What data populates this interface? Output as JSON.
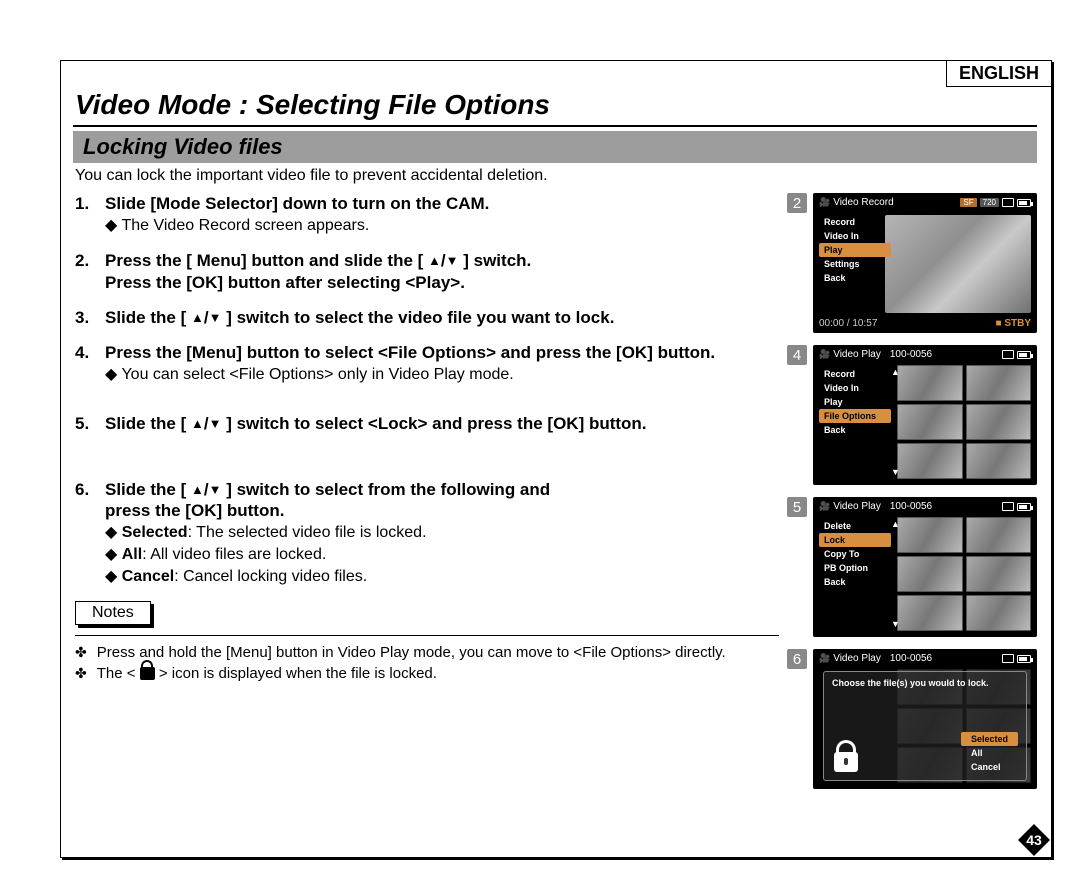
{
  "lang_label": "ENGLISH",
  "title": "Video Mode : Selecting File Options",
  "subtitle": "Locking Video files",
  "intro": "You can lock the important video file to prevent accidental deletion.",
  "steps": {
    "s1_num": "1.",
    "s1_head": "Slide [Mode Selector] down to turn on the CAM.",
    "s1_sub": "The Video Record screen appears.",
    "s2_num": "2.",
    "s2_head_l1_a": "Press the [ Menu] button and slide the [",
    "s2_head_l1_b": "] switch.",
    "s2_head_l2": "Press the [OK] button after selecting <Play>.",
    "s3_num": "3.",
    "s3_head_a": "Slide the [",
    "s3_head_b": "] switch to select the video file you want to lock.",
    "s4_num": "4.",
    "s4_head": "Press the [Menu] button to select <File Options> and press the [OK] button.",
    "s4_sub": "You can select <File Options> only in Video Play mode.",
    "s5_num": "5.",
    "s5_head_a": "Slide the [",
    "s5_head_b": "] switch to select <Lock> and press the [OK] button.",
    "s6_num": "6.",
    "s6_head_a": "Slide the [",
    "s6_head_b": "] switch to select from the following and",
    "s6_head_l2": "press the [OK] button.",
    "s6_sub1_b": "Selected",
    "s6_sub1_t": ": The selected video file is locked.",
    "s6_sub2_b": "All",
    "s6_sub2_t": ": All video files are locked.",
    "s6_sub3_b": "Cancel",
    "s6_sub3_t": ": Cancel locking video files."
  },
  "notes_label": "Notes",
  "notes": {
    "n1": "Press and hold the [Menu] button in Video Play mode, you can move to <File Options> directly.",
    "n2_a": "The < ",
    "n2_b": " > icon is displayed when the file is locked."
  },
  "screens": {
    "s2": {
      "num": "2",
      "mode": "Video Record",
      "sf": "SF",
      "res": "720",
      "menu": [
        "Record",
        "Video In",
        "Play",
        "Settings",
        "Back"
      ],
      "hl": "Play",
      "time": "00:00 / 10:57",
      "stby_icon": "■",
      "stby": "STBY"
    },
    "s4": {
      "num": "4",
      "mode": "Video Play",
      "folder": "100-0056",
      "menu": [
        "Record",
        "Video In",
        "Play",
        "File Options",
        "Back"
      ],
      "hl": "File Options"
    },
    "s5": {
      "num": "5",
      "mode": "Video Play",
      "folder": "100-0056",
      "menu": [
        "Delete",
        "Lock",
        "Copy To",
        "PB Option",
        "Back"
      ],
      "hl": "Lock"
    },
    "s6": {
      "num": "6",
      "mode": "Video Play",
      "folder": "100-0056",
      "prompt": "Choose the file(s) you would to lock.",
      "opts": [
        "Selected",
        "All",
        "Cancel"
      ],
      "hl": "Selected"
    }
  },
  "page_number": "43"
}
